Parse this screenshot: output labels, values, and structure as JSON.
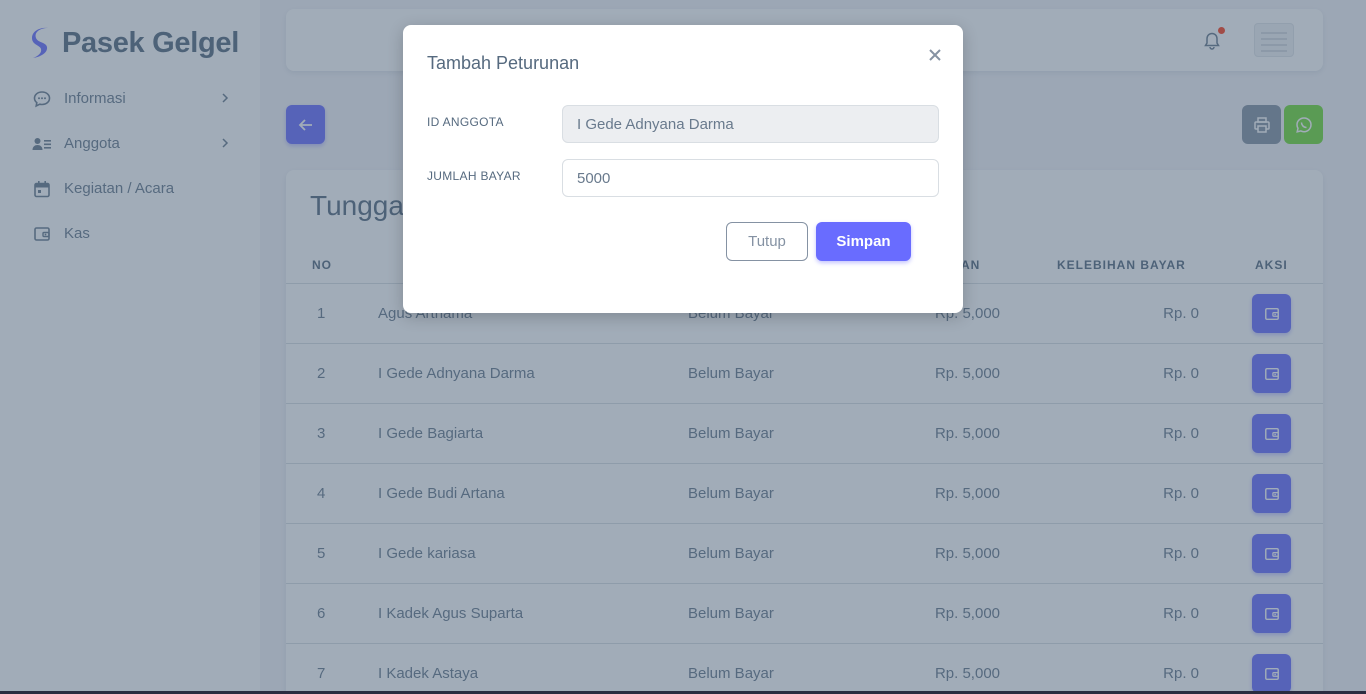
{
  "brand": {
    "name": "Pasek Gelgel",
    "accent": "#696cff"
  },
  "sidebar": {
    "items": [
      {
        "label": "Informasi",
        "icon": "chat-bubble-icon",
        "has_chevron": true
      },
      {
        "label": "Anggota",
        "icon": "user-list-icon",
        "has_chevron": true
      },
      {
        "label": "Kegiatan / Acara",
        "icon": "calendar-icon",
        "has_chevron": false
      },
      {
        "label": "Kas",
        "icon": "wallet-icon",
        "has_chevron": false
      }
    ]
  },
  "navbar": {
    "notification_icon": "bell-icon",
    "has_notification": true
  },
  "toolbar": {
    "back_icon": "arrow-left-icon",
    "print_icon": "printer-icon",
    "whatsapp_icon": "whatsapp-icon"
  },
  "card": {
    "title": "Tungga",
    "columns": [
      "NO",
      "",
      "",
      "AN",
      "KELEBIHAN BAYAR",
      "AKSI"
    ],
    "rows": [
      {
        "no": "1",
        "nama": "Agus Arthama",
        "status": "Belum Bayar",
        "tagihan": "Rp. 5,000",
        "kelebihan": "Rp. 0"
      },
      {
        "no": "2",
        "nama": "I Gede Adnyana Darma",
        "status": "Belum Bayar",
        "tagihan": "Rp. 5,000",
        "kelebihan": "Rp. 0"
      },
      {
        "no": "3",
        "nama": "I Gede Bagiarta",
        "status": "Belum Bayar",
        "tagihan": "Rp. 5,000",
        "kelebihan": "Rp. 0"
      },
      {
        "no": "4",
        "nama": "I Gede Budi Artana",
        "status": "Belum Bayar",
        "tagihan": "Rp. 5,000",
        "kelebihan": "Rp. 0"
      },
      {
        "no": "5",
        "nama": "I Gede kariasa",
        "status": "Belum Bayar",
        "tagihan": "Rp. 5,000",
        "kelebihan": "Rp. 0"
      },
      {
        "no": "6",
        "nama": "I Kadek Agus Suparta",
        "status": "Belum Bayar",
        "tagihan": "Rp. 5,000",
        "kelebihan": "Rp. 0"
      },
      {
        "no": "7",
        "nama": "I Kadek Astaya",
        "status": "Belum Bayar",
        "tagihan": "Rp. 5,000",
        "kelebihan": "Rp. 0"
      }
    ],
    "action_icon": "wallet-icon"
  },
  "modal": {
    "title": "Tambah Peturunan",
    "close_icon": "close-icon",
    "fields": [
      {
        "label": "ID ANGGOTA",
        "value": "I Gede Adnyana Darma",
        "readonly": true
      },
      {
        "label": "JUMLAH BAYAR",
        "value": "5000",
        "readonly": false
      }
    ],
    "cancel_label": "Tutup",
    "submit_label": "Simpan"
  }
}
